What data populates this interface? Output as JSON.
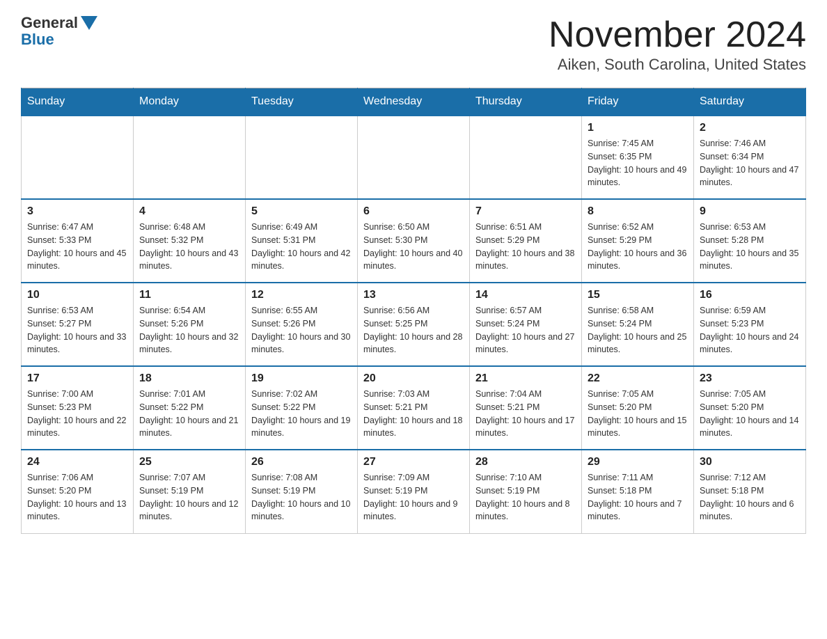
{
  "logo": {
    "text": "General",
    "blue": "Blue"
  },
  "title": "November 2024",
  "subtitle": "Aiken, South Carolina, United States",
  "days_of_week": [
    "Sunday",
    "Monday",
    "Tuesday",
    "Wednesday",
    "Thursday",
    "Friday",
    "Saturday"
  ],
  "weeks": [
    [
      {
        "day": "",
        "info": ""
      },
      {
        "day": "",
        "info": ""
      },
      {
        "day": "",
        "info": ""
      },
      {
        "day": "",
        "info": ""
      },
      {
        "day": "",
        "info": ""
      },
      {
        "day": "1",
        "info": "Sunrise: 7:45 AM\nSunset: 6:35 PM\nDaylight: 10 hours and 49 minutes."
      },
      {
        "day": "2",
        "info": "Sunrise: 7:46 AM\nSunset: 6:34 PM\nDaylight: 10 hours and 47 minutes."
      }
    ],
    [
      {
        "day": "3",
        "info": "Sunrise: 6:47 AM\nSunset: 5:33 PM\nDaylight: 10 hours and 45 minutes."
      },
      {
        "day": "4",
        "info": "Sunrise: 6:48 AM\nSunset: 5:32 PM\nDaylight: 10 hours and 43 minutes."
      },
      {
        "day": "5",
        "info": "Sunrise: 6:49 AM\nSunset: 5:31 PM\nDaylight: 10 hours and 42 minutes."
      },
      {
        "day": "6",
        "info": "Sunrise: 6:50 AM\nSunset: 5:30 PM\nDaylight: 10 hours and 40 minutes."
      },
      {
        "day": "7",
        "info": "Sunrise: 6:51 AM\nSunset: 5:29 PM\nDaylight: 10 hours and 38 minutes."
      },
      {
        "day": "8",
        "info": "Sunrise: 6:52 AM\nSunset: 5:29 PM\nDaylight: 10 hours and 36 minutes."
      },
      {
        "day": "9",
        "info": "Sunrise: 6:53 AM\nSunset: 5:28 PM\nDaylight: 10 hours and 35 minutes."
      }
    ],
    [
      {
        "day": "10",
        "info": "Sunrise: 6:53 AM\nSunset: 5:27 PM\nDaylight: 10 hours and 33 minutes."
      },
      {
        "day": "11",
        "info": "Sunrise: 6:54 AM\nSunset: 5:26 PM\nDaylight: 10 hours and 32 minutes."
      },
      {
        "day": "12",
        "info": "Sunrise: 6:55 AM\nSunset: 5:26 PM\nDaylight: 10 hours and 30 minutes."
      },
      {
        "day": "13",
        "info": "Sunrise: 6:56 AM\nSunset: 5:25 PM\nDaylight: 10 hours and 28 minutes."
      },
      {
        "day": "14",
        "info": "Sunrise: 6:57 AM\nSunset: 5:24 PM\nDaylight: 10 hours and 27 minutes."
      },
      {
        "day": "15",
        "info": "Sunrise: 6:58 AM\nSunset: 5:24 PM\nDaylight: 10 hours and 25 minutes."
      },
      {
        "day": "16",
        "info": "Sunrise: 6:59 AM\nSunset: 5:23 PM\nDaylight: 10 hours and 24 minutes."
      }
    ],
    [
      {
        "day": "17",
        "info": "Sunrise: 7:00 AM\nSunset: 5:23 PM\nDaylight: 10 hours and 22 minutes."
      },
      {
        "day": "18",
        "info": "Sunrise: 7:01 AM\nSunset: 5:22 PM\nDaylight: 10 hours and 21 minutes."
      },
      {
        "day": "19",
        "info": "Sunrise: 7:02 AM\nSunset: 5:22 PM\nDaylight: 10 hours and 19 minutes."
      },
      {
        "day": "20",
        "info": "Sunrise: 7:03 AM\nSunset: 5:21 PM\nDaylight: 10 hours and 18 minutes."
      },
      {
        "day": "21",
        "info": "Sunrise: 7:04 AM\nSunset: 5:21 PM\nDaylight: 10 hours and 17 minutes."
      },
      {
        "day": "22",
        "info": "Sunrise: 7:05 AM\nSunset: 5:20 PM\nDaylight: 10 hours and 15 minutes."
      },
      {
        "day": "23",
        "info": "Sunrise: 7:05 AM\nSunset: 5:20 PM\nDaylight: 10 hours and 14 minutes."
      }
    ],
    [
      {
        "day": "24",
        "info": "Sunrise: 7:06 AM\nSunset: 5:20 PM\nDaylight: 10 hours and 13 minutes."
      },
      {
        "day": "25",
        "info": "Sunrise: 7:07 AM\nSunset: 5:19 PM\nDaylight: 10 hours and 12 minutes."
      },
      {
        "day": "26",
        "info": "Sunrise: 7:08 AM\nSunset: 5:19 PM\nDaylight: 10 hours and 10 minutes."
      },
      {
        "day": "27",
        "info": "Sunrise: 7:09 AM\nSunset: 5:19 PM\nDaylight: 10 hours and 9 minutes."
      },
      {
        "day": "28",
        "info": "Sunrise: 7:10 AM\nSunset: 5:19 PM\nDaylight: 10 hours and 8 minutes."
      },
      {
        "day": "29",
        "info": "Sunrise: 7:11 AM\nSunset: 5:18 PM\nDaylight: 10 hours and 7 minutes."
      },
      {
        "day": "30",
        "info": "Sunrise: 7:12 AM\nSunset: 5:18 PM\nDaylight: 10 hours and 6 minutes."
      }
    ]
  ]
}
